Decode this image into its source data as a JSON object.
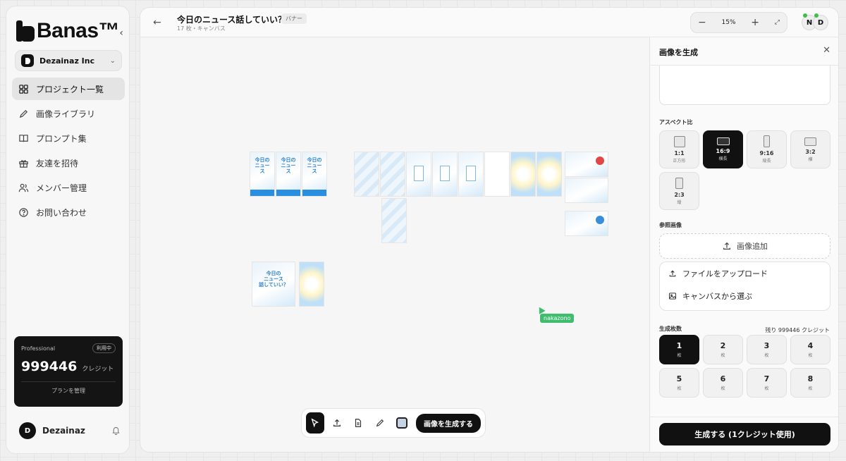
{
  "brand": {
    "name": "Banas™"
  },
  "org": {
    "name": "Dezainaz Inc"
  },
  "nav": [
    {
      "label": "プロジェクト一覧",
      "icon": "grid-icon",
      "active": true
    },
    {
      "label": "画像ライブラリ",
      "icon": "pencil-icon",
      "active": false
    },
    {
      "label": "プロンプト集",
      "icon": "book-icon",
      "active": false
    },
    {
      "label": "友達を招待",
      "icon": "gift-icon",
      "active": false
    },
    {
      "label": "メンバー管理",
      "icon": "users-icon",
      "active": false
    },
    {
      "label": "お問い合わせ",
      "icon": "help-circle-icon",
      "active": false
    }
  ],
  "plan": {
    "name": "Professional",
    "badge": "利用中",
    "credits": "999446",
    "unit": "クレジット",
    "manage": "プランを管理"
  },
  "user": {
    "initial": "D",
    "name": "Dezainaz"
  },
  "project": {
    "title": "今日のニュース話していい？",
    "tag": "バナー",
    "subtitle": "17 枚・キャンバス"
  },
  "zoom": {
    "minus": "−",
    "value": "15%",
    "plus": "+"
  },
  "collaborators": [
    "N",
    "D"
  ],
  "canvas": {
    "cursor_user": "nakazono"
  },
  "toolbar": {
    "generate": "画像を生成する",
    "swatch_color": "#c5d3e4"
  },
  "panel": {
    "title": "画像を生成",
    "aspect_label": "アスペクト比",
    "aspects": [
      {
        "ratio": "1:1",
        "sub": "正方形",
        "active": false
      },
      {
        "ratio": "16:9",
        "sub": "横長",
        "active": true
      },
      {
        "ratio": "9:16",
        "sub": "縦長",
        "active": false
      },
      {
        "ratio": "3:2",
        "sub": "横",
        "active": false
      },
      {
        "ratio": "2:3",
        "sub": "縦",
        "active": false
      }
    ],
    "ref_label": "参照画像",
    "add_image": "画像追加",
    "upload": "ファイルをアップロード",
    "from_canvas": "キャンバスから選ぶ",
    "count_label": "生成枚数",
    "remaining": "残り 999446 クレジット",
    "count_unit": "枚",
    "counts": [
      "1",
      "2",
      "3",
      "4",
      "5",
      "6",
      "7",
      "8"
    ],
    "count_selected": "1",
    "submit": "生成する (1クレジット使用)"
  }
}
